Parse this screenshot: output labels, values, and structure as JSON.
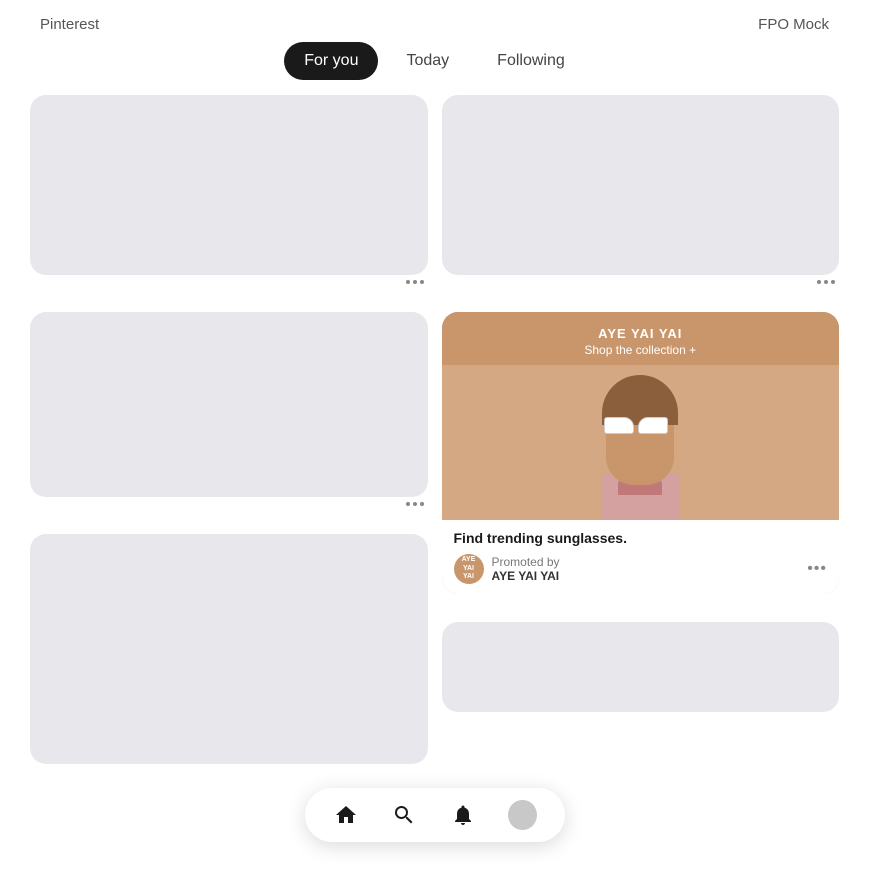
{
  "header": {
    "logo": "Pinterest",
    "fpo": "FPO Mock"
  },
  "tabs": [
    {
      "id": "for-you",
      "label": "For you",
      "active": true
    },
    {
      "id": "today",
      "label": "Today",
      "active": false
    },
    {
      "id": "following",
      "label": "Following",
      "active": false
    }
  ],
  "ad": {
    "brand_title": "AYE YAI YAI",
    "shop_text": "Shop the collection +",
    "find_text": "Find trending sunglasses.",
    "promoted_label": "Promoted by",
    "brand_name": "AYE YAI YAI",
    "avatar_text": "AYE\nYAI\nYAI"
  },
  "nav": {
    "home_label": "Home",
    "search_label": "Search",
    "notifications_label": "Notifications",
    "profile_label": "Profile"
  },
  "dots_label": "..."
}
